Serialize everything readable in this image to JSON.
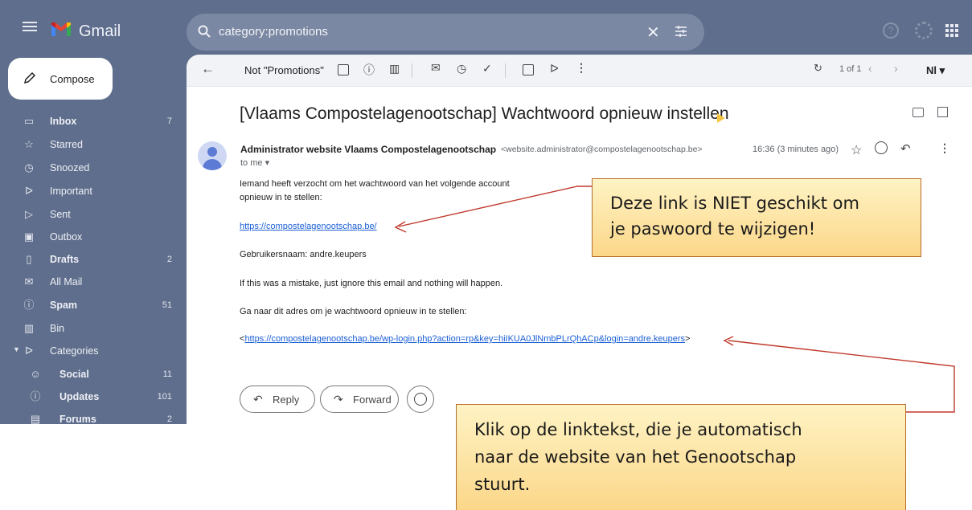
{
  "app": {
    "name": "Gmail"
  },
  "search": {
    "query": "category:promotions"
  },
  "compose": {
    "label": "Compose"
  },
  "nav": [
    {
      "label": "Inbox",
      "count": "7",
      "icon": "inbox-icon",
      "bold": true
    },
    {
      "label": "Starred",
      "count": "",
      "icon": "star-icon",
      "bold": false
    },
    {
      "label": "Snoozed",
      "count": "",
      "icon": "clock-icon",
      "bold": false
    },
    {
      "label": "Important",
      "count": "",
      "icon": "important-icon",
      "bold": false
    },
    {
      "label": "Sent",
      "count": "",
      "icon": "send-icon",
      "bold": false
    },
    {
      "label": "Outbox",
      "count": "",
      "icon": "outbox-icon",
      "bold": false
    },
    {
      "label": "Drafts",
      "count": "2",
      "icon": "draft-icon",
      "bold": true
    },
    {
      "label": "All Mail",
      "count": "",
      "icon": "all-mail-icon",
      "bold": false
    },
    {
      "label": "Spam",
      "count": "51",
      "icon": "spam-icon",
      "bold": true
    },
    {
      "label": "Bin",
      "count": "",
      "icon": "bin-icon",
      "bold": false
    },
    {
      "label": "Categories",
      "count": "",
      "icon": "label-icon",
      "bold": false
    },
    {
      "label": "Social",
      "count": "11",
      "icon": "social-icon",
      "bold": true
    },
    {
      "label": "Updates",
      "count": "101",
      "icon": "updates-icon",
      "bold": true
    },
    {
      "label": "Forums",
      "count": "2",
      "icon": "forums-icon",
      "bold": true
    }
  ],
  "toolbar": {
    "not_promotions": "Not \"Promotions\"",
    "pager": "1 of 1",
    "language": "Nl"
  },
  "email": {
    "subject": "[Vlaams Compostelagenootschap] Wachtwoord opnieuw instellen",
    "sender_name": "Administrator website Vlaams Compostelagenootschap",
    "sender_email": "<website.administrator@compostelagenootschap.be>",
    "time": "16:36 (3 minutes ago)",
    "to": "to me",
    "line1": "Iemand heeft verzocht om het wachtwoord van het volgende account",
    "line2": "opnieuw in te stellen:",
    "site_link": "https://compostelagenootschap.be/",
    "username_line": "Gebruikersnaam: andre.keupers",
    "mistake_line": "If this was a mistake, just ignore this email and nothing will happen.",
    "goto_line": "Ga naar dit adres om je wachtwoord opnieuw in te stellen:",
    "reset_link": "https://compostelagenootschap.be/wp-login.php?action=rp&key=hiIKUA0JlNmbPLrQhACp&login=andre.keupers",
    "link_open": "<",
    "link_close": ">"
  },
  "actions": {
    "reply": "Reply",
    "forward": "Forward"
  },
  "callouts": {
    "top_line1": "Deze link is NIET geschikt om",
    "top_line2": "je paswoord te wijzigen!",
    "bottom_line1": "Klik op de linktekst, die je automatisch",
    "bottom_line2": "naar de website van het Genootschap",
    "bottom_line3": "stuurt."
  },
  "colors": {
    "frame": "#5f6e8c",
    "link": "#1a5fd6",
    "callout_border": "#b56c2a",
    "arrow": "#c0392b"
  }
}
